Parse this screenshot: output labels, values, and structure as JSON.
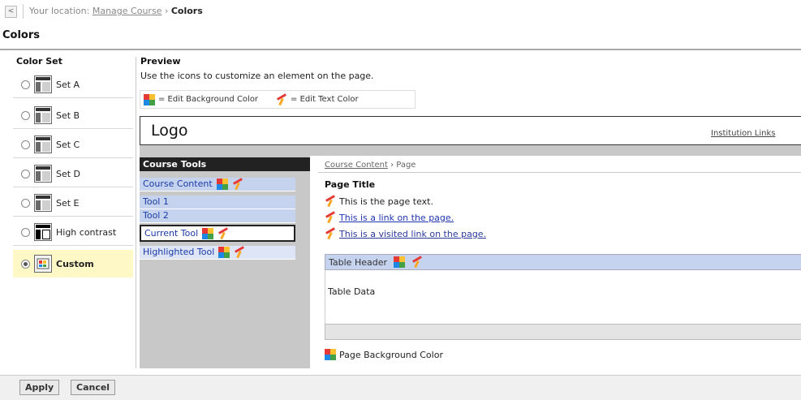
{
  "breadcrumb": {
    "back_glyph": "<",
    "prefix": "Your location:",
    "link": "Manage Course",
    "sep": "›",
    "current": "Colors"
  },
  "page_title": "Colors",
  "color_set": {
    "heading": "Color Set",
    "items": [
      {
        "label": "Set A",
        "selected": false
      },
      {
        "label": "Set B",
        "selected": false
      },
      {
        "label": "Set C",
        "selected": false
      },
      {
        "label": "Set D",
        "selected": false
      },
      {
        "label": "Set E",
        "selected": false
      },
      {
        "label": "High contrast",
        "selected": false
      },
      {
        "label": "Custom",
        "selected": true
      }
    ]
  },
  "preview": {
    "heading": "Preview",
    "description": "Use the icons to customize an element on the page.",
    "legend_bg": "= Edit Background Color",
    "legend_text": "= Edit Text Color",
    "logo": "Logo",
    "institution_links": "Institution Links",
    "course_tools": {
      "header": "Course Tools",
      "items": [
        "Course Content",
        "Tool 1",
        "Tool 2",
        "Current Tool",
        "Highlighted Tool"
      ]
    },
    "content": {
      "crumb_link": "Course Content",
      "crumb_sep": "›",
      "crumb_current": "Page",
      "page_title": "Page Title",
      "page_text": "This is the page text.",
      "link_text": "This is a link on the page.",
      "visited_link_text": "This is a visited link on the page.",
      "table_header": "Table Header",
      "table_data": "Table Data",
      "page_background": "Page Background Color"
    }
  },
  "buttons": {
    "apply": "Apply",
    "cancel": "Cancel"
  },
  "colors": {
    "tools_header_bg": "#222222",
    "tool_row_bg": "#c6d3ee",
    "link_color": "#1f33b0",
    "custom_highlight": "#fdf8c6",
    "panel_gray": "#c8c8c8"
  }
}
